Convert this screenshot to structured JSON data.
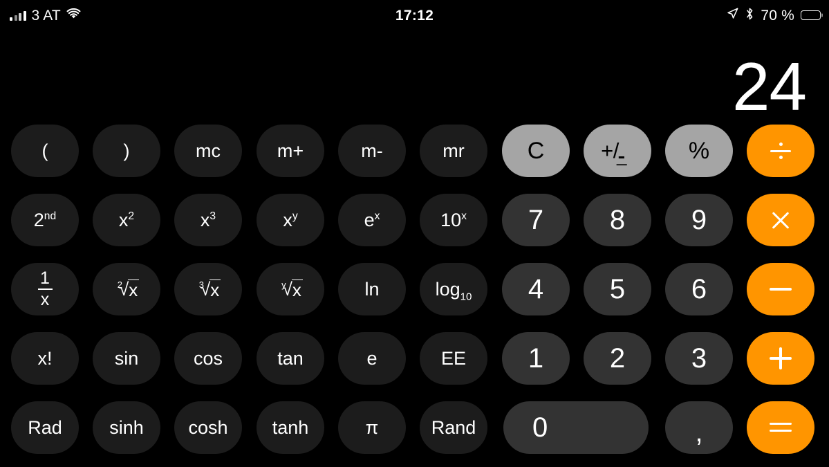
{
  "status_bar": {
    "signal_label": "3 AT",
    "signal_icon": "cellular-bars-icon",
    "wifi_icon": "wifi-icon",
    "time": "17:12",
    "location_icon": "location-arrow-icon",
    "bluetooth_icon": "bluetooth-icon",
    "battery_percent": "70 %",
    "battery_icon": "battery-icon",
    "battery_level": 70
  },
  "display": {
    "value": "24"
  },
  "keypad": {
    "rows": [
      {
        "keys": [
          {
            "name": "open-paren",
            "label": "(",
            "style": "fn"
          },
          {
            "name": "close-paren",
            "label": ")",
            "style": "fn"
          },
          {
            "name": "memory-clear",
            "label": "mc",
            "style": "fn"
          },
          {
            "name": "memory-add",
            "label": "m+",
            "style": "fn"
          },
          {
            "name": "memory-subtract",
            "label": "m-",
            "style": "fn"
          },
          {
            "name": "memory-recall",
            "label": "mr",
            "style": "fn"
          },
          {
            "name": "clear",
            "label": "C",
            "style": "util"
          },
          {
            "name": "plus-minus",
            "label": "+/-",
            "style": "util"
          },
          {
            "name": "percent",
            "label": "%",
            "style": "util"
          },
          {
            "name": "divide",
            "label": "÷",
            "style": "op"
          }
        ]
      },
      {
        "keys": [
          {
            "name": "second-function",
            "label": "2nd",
            "style": "fn"
          },
          {
            "name": "square",
            "label": "x²",
            "style": "fn"
          },
          {
            "name": "cube",
            "label": "x³",
            "style": "fn"
          },
          {
            "name": "power-y",
            "label": "xʸ",
            "style": "fn"
          },
          {
            "name": "e-power-x",
            "label": "eˣ",
            "style": "fn"
          },
          {
            "name": "ten-power-x",
            "label": "10ˣ",
            "style": "fn"
          },
          {
            "name": "digit-7",
            "label": "7",
            "style": "num"
          },
          {
            "name": "digit-8",
            "label": "8",
            "style": "num"
          },
          {
            "name": "digit-9",
            "label": "9",
            "style": "num"
          },
          {
            "name": "multiply",
            "label": "×",
            "style": "op"
          }
        ]
      },
      {
        "keys": [
          {
            "name": "reciprocal",
            "label": "1/x",
            "style": "fn"
          },
          {
            "name": "square-root",
            "label": "²√x",
            "style": "fn"
          },
          {
            "name": "cube-root",
            "label": "³√x",
            "style": "fn"
          },
          {
            "name": "y-root",
            "label": "ʸ√x",
            "style": "fn"
          },
          {
            "name": "natural-log",
            "label": "ln",
            "style": "fn"
          },
          {
            "name": "log-base-10",
            "label": "log10",
            "style": "fn"
          },
          {
            "name": "digit-4",
            "label": "4",
            "style": "num"
          },
          {
            "name": "digit-5",
            "label": "5",
            "style": "num"
          },
          {
            "name": "digit-6",
            "label": "6",
            "style": "num"
          },
          {
            "name": "subtract",
            "label": "−",
            "style": "op"
          }
        ]
      },
      {
        "keys": [
          {
            "name": "factorial",
            "label": "x!",
            "style": "fn"
          },
          {
            "name": "sine",
            "label": "sin",
            "style": "fn"
          },
          {
            "name": "cosine",
            "label": "cos",
            "style": "fn"
          },
          {
            "name": "tangent",
            "label": "tan",
            "style": "fn"
          },
          {
            "name": "euler-constant",
            "label": "e",
            "style": "fn"
          },
          {
            "name": "exponent-ee",
            "label": "EE",
            "style": "fn"
          },
          {
            "name": "digit-1",
            "label": "1",
            "style": "num"
          },
          {
            "name": "digit-2",
            "label": "2",
            "style": "num"
          },
          {
            "name": "digit-3",
            "label": "3",
            "style": "num"
          },
          {
            "name": "add",
            "label": "+",
            "style": "op"
          }
        ]
      },
      {
        "keys": [
          {
            "name": "radian-mode",
            "label": "Rad",
            "style": "fn"
          },
          {
            "name": "hyperbolic-sine",
            "label": "sinh",
            "style": "fn"
          },
          {
            "name": "hyperbolic-cosine",
            "label": "cosh",
            "style": "fn"
          },
          {
            "name": "hyperbolic-tangent",
            "label": "tanh",
            "style": "fn"
          },
          {
            "name": "pi-constant",
            "label": "π",
            "style": "fn"
          },
          {
            "name": "random",
            "label": "Rand",
            "style": "fn"
          },
          {
            "name": "digit-0",
            "label": "0",
            "style": "num"
          },
          {
            "name": "decimal-separator",
            "label": ",",
            "style": "num"
          },
          {
            "name": "equals",
            "label": "=",
            "style": "op"
          }
        ]
      }
    ],
    "fragments": {
      "second_base": "2",
      "second_sup": "nd",
      "x_base": "x",
      "sup_2": "2",
      "sup_3": "3",
      "sup_y": "y",
      "e_base": "e",
      "sup_x": "x",
      "ten_base": "10",
      "log_base": "log",
      "log_sub": "10",
      "frac_num": "1",
      "frac_den": "x",
      "rad_index_2": "2",
      "rad_index_3": "3",
      "rad_index_y": "y",
      "rad_radicand": "x"
    }
  },
  "colors": {
    "background": "#000000",
    "function_key": "#1c1c1c",
    "number_key": "#333333",
    "utility_key": "#a5a5a5",
    "operator_key": "#ff9500",
    "text_light": "#ffffff",
    "text_dark": "#000000"
  }
}
